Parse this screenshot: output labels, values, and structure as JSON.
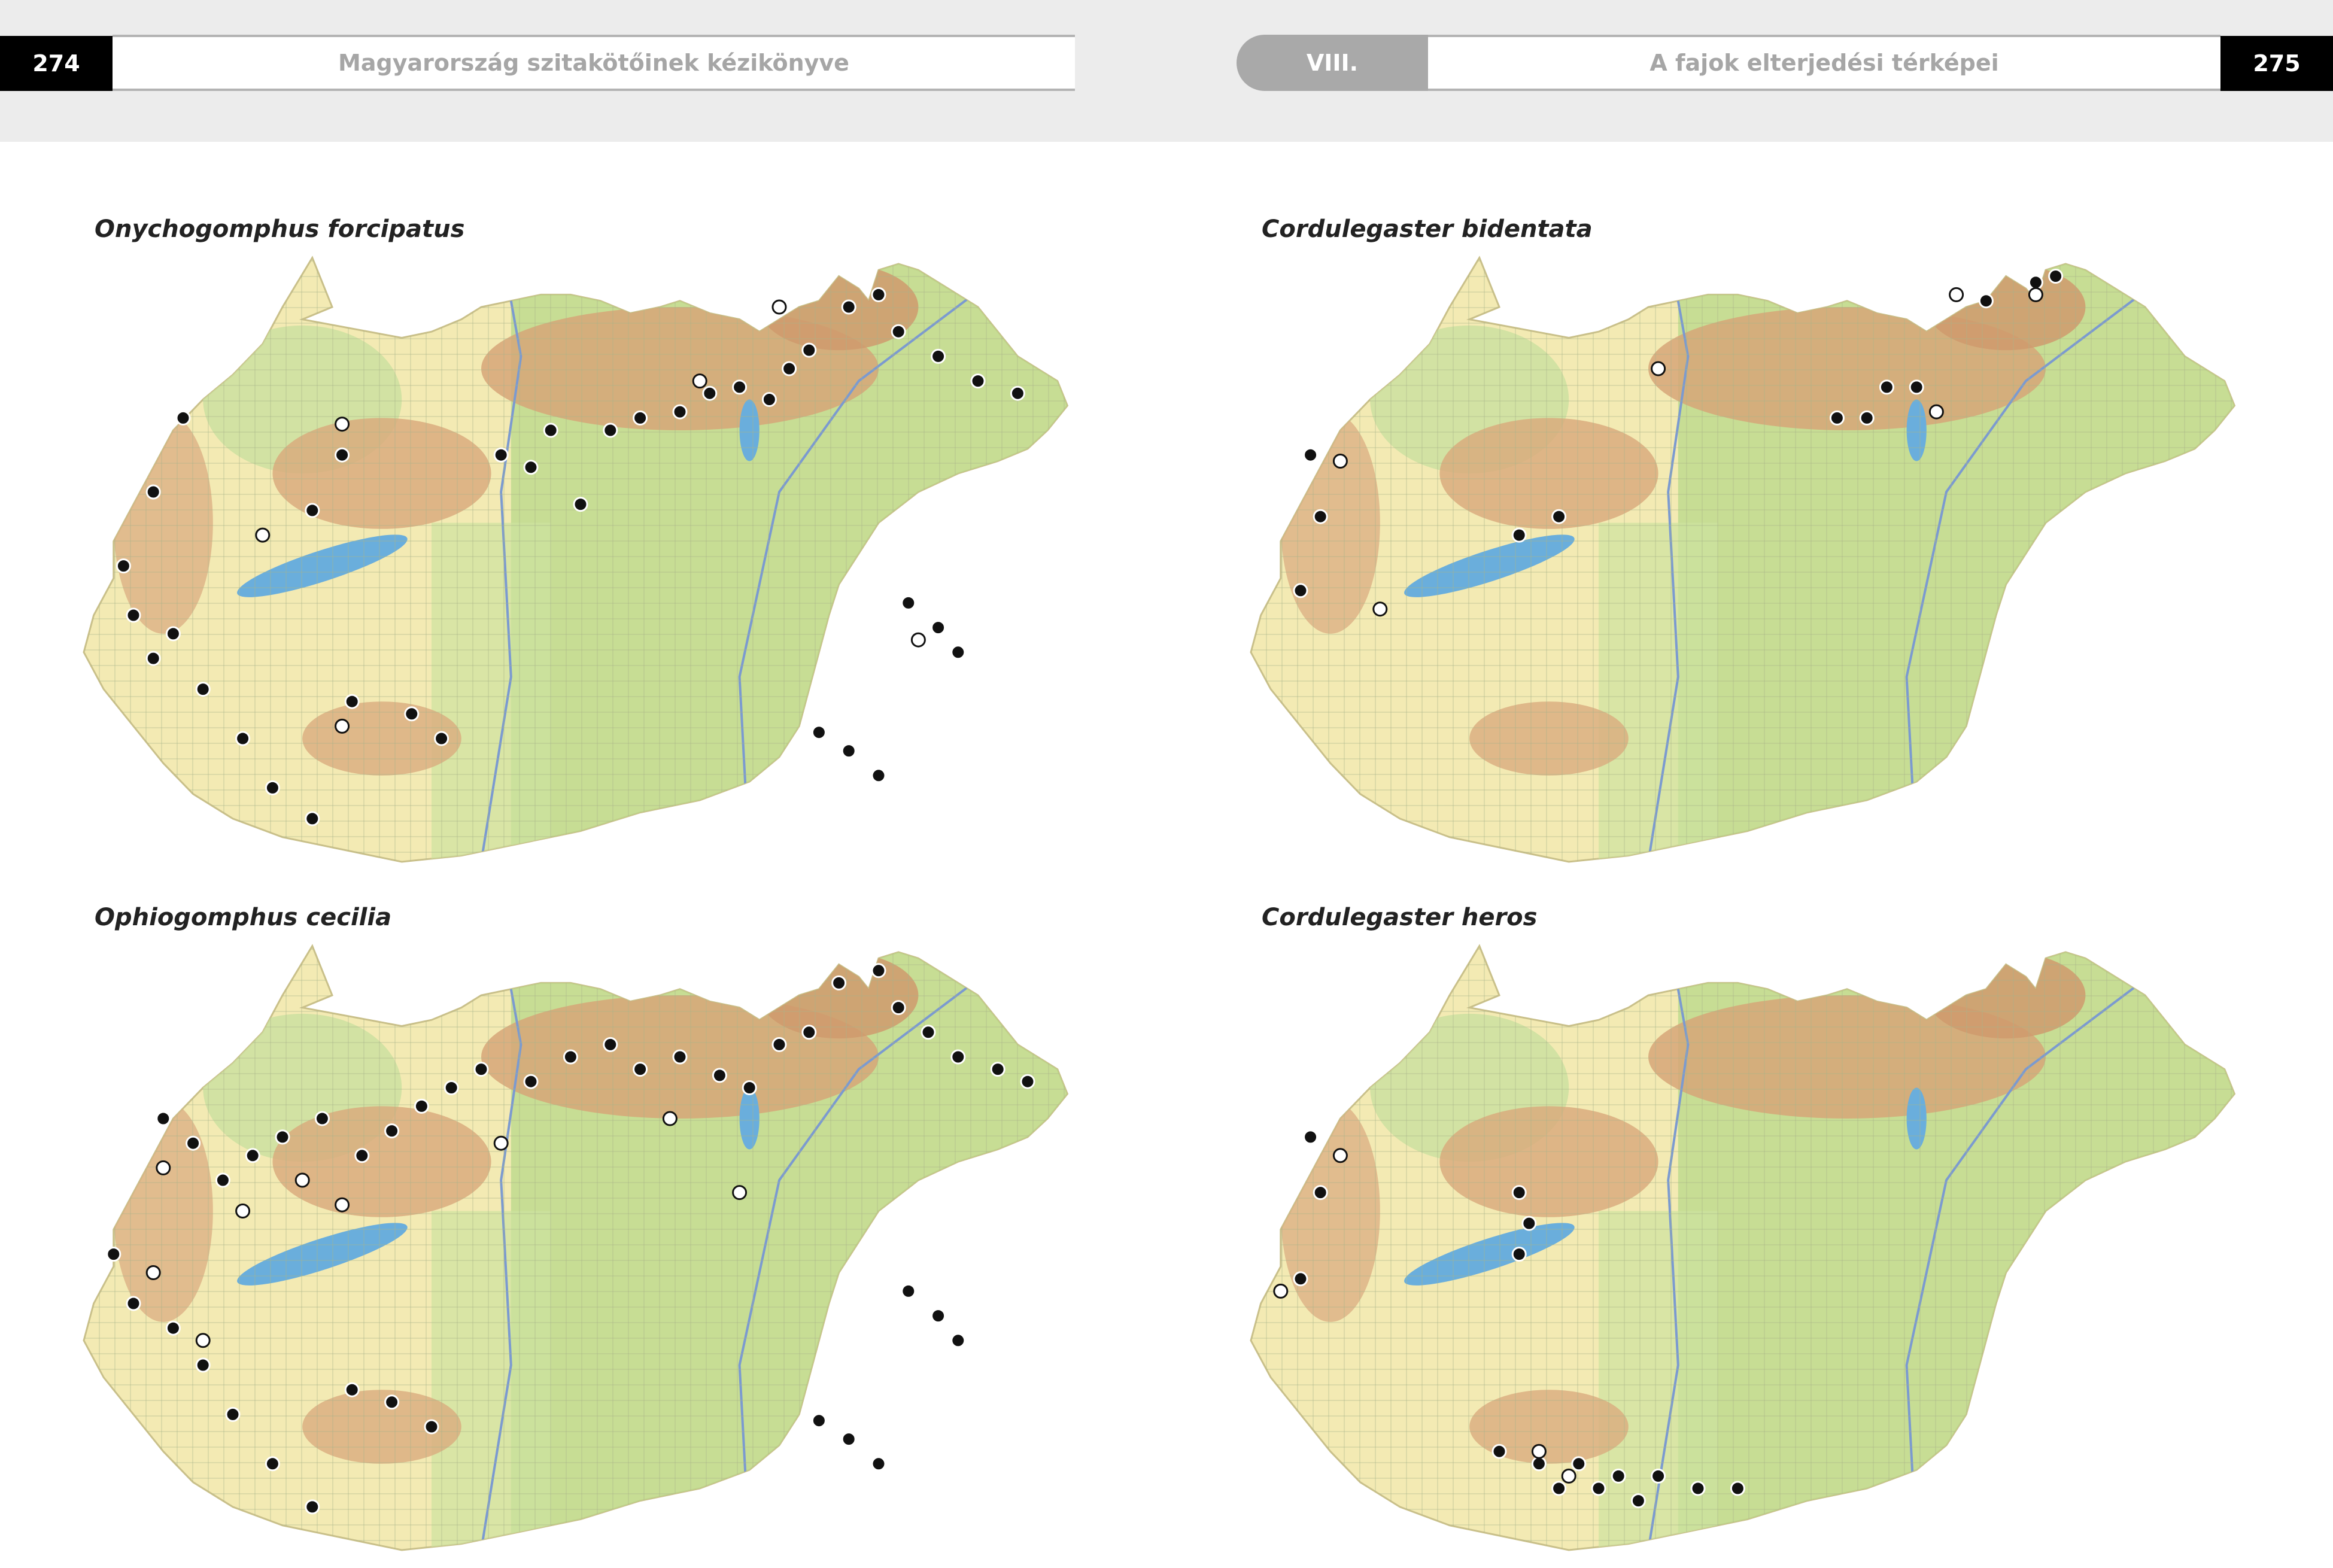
{
  "header": {
    "left_page_number": "274",
    "left_title": "Magyarország szitakötőinek kézikönyve",
    "chapter": "VIII.",
    "right_title": "A fajok elterjedési térképei",
    "right_page_number": "275"
  },
  "maps": [
    {
      "species": "Onychogomphus forcipatus",
      "filled": [
        [
          0.23,
          0.02
        ],
        [
          0.24,
          0.06
        ],
        [
          0.25,
          0.1
        ],
        [
          0.22,
          0.12
        ],
        [
          0.32,
          0.15
        ],
        [
          0.35,
          0.14
        ],
        [
          0.38,
          0.12
        ],
        [
          0.4,
          0.1
        ],
        [
          0.43,
          0.09
        ],
        [
          0.46,
          0.08
        ],
        [
          0.49,
          0.08
        ],
        [
          0.52,
          0.09
        ],
        [
          0.55,
          0.11
        ],
        [
          0.58,
          0.1
        ],
        [
          0.6,
          0.09
        ],
        [
          0.63,
          0.11
        ],
        [
          0.66,
          0.12
        ],
        [
          0.68,
          0.14
        ],
        [
          0.7,
          0.12
        ],
        [
          0.72,
          0.1
        ],
        [
          0.74,
          0.09
        ],
        [
          0.76,
          0.05
        ],
        [
          0.78,
          0.07
        ],
        [
          0.79,
          0.09
        ],
        [
          0.8,
          0.04
        ],
        [
          0.82,
          0.03
        ],
        [
          0.84,
          0.04
        ],
        [
          0.86,
          0.06
        ],
        [
          0.88,
          0.08
        ],
        [
          0.9,
          0.1
        ],
        [
          0.92,
          0.14
        ],
        [
          0.94,
          0.18
        ],
        [
          0.96,
          0.2
        ],
        [
          0.98,
          0.22
        ],
        [
          0.99,
          0.26
        ],
        [
          0.97,
          0.3
        ],
        [
          0.95,
          0.33
        ],
        [
          0.92,
          0.35
        ],
        [
          0.88,
          0.37
        ],
        [
          0.84,
          0.4
        ],
        [
          0.8,
          0.45
        ],
        [
          0.78,
          0.5
        ],
        [
          0.76,
          0.55
        ],
        [
          0.75,
          0.6
        ],
        [
          0.74,
          0.66
        ],
        [
          0.73,
          0.72
        ],
        [
          0.72,
          0.78
        ],
        [
          0.7,
          0.83
        ],
        [
          0.67,
          0.87
        ],
        [
          0.62,
          0.9
        ],
        [
          0.56,
          0.92
        ],
        [
          0.5,
          0.95
        ],
        [
          0.44,
          0.97
        ],
        [
          0.38,
          0.99
        ],
        [
          0.32,
          1.0
        ],
        [
          0.26,
          0.98
        ],
        [
          0.2,
          0.96
        ],
        [
          0.15,
          0.93
        ],
        [
          0.11,
          0.89
        ],
        [
          0.08,
          0.84
        ],
        [
          0.05,
          0.78
        ],
        [
          0.02,
          0.72
        ],
        [
          0.0,
          0.66
        ],
        [
          0.01,
          0.6
        ],
        [
          0.03,
          0.54
        ],
        [
          0.03,
          0.48
        ],
        [
          0.05,
          0.42
        ],
        [
          0.07,
          0.36
        ],
        [
          0.09,
          0.3
        ],
        [
          0.12,
          0.25
        ],
        [
          0.15,
          0.21
        ],
        [
          0.18,
          0.16
        ],
        [
          0.2,
          0.1
        ]
      ]
    },
    {
      "species": "Cordulegaster bidentata"
    },
    {
      "species": "Ophiogomphus cecilia"
    },
    {
      "species": "Cordulegaster heros"
    }
  ]
}
